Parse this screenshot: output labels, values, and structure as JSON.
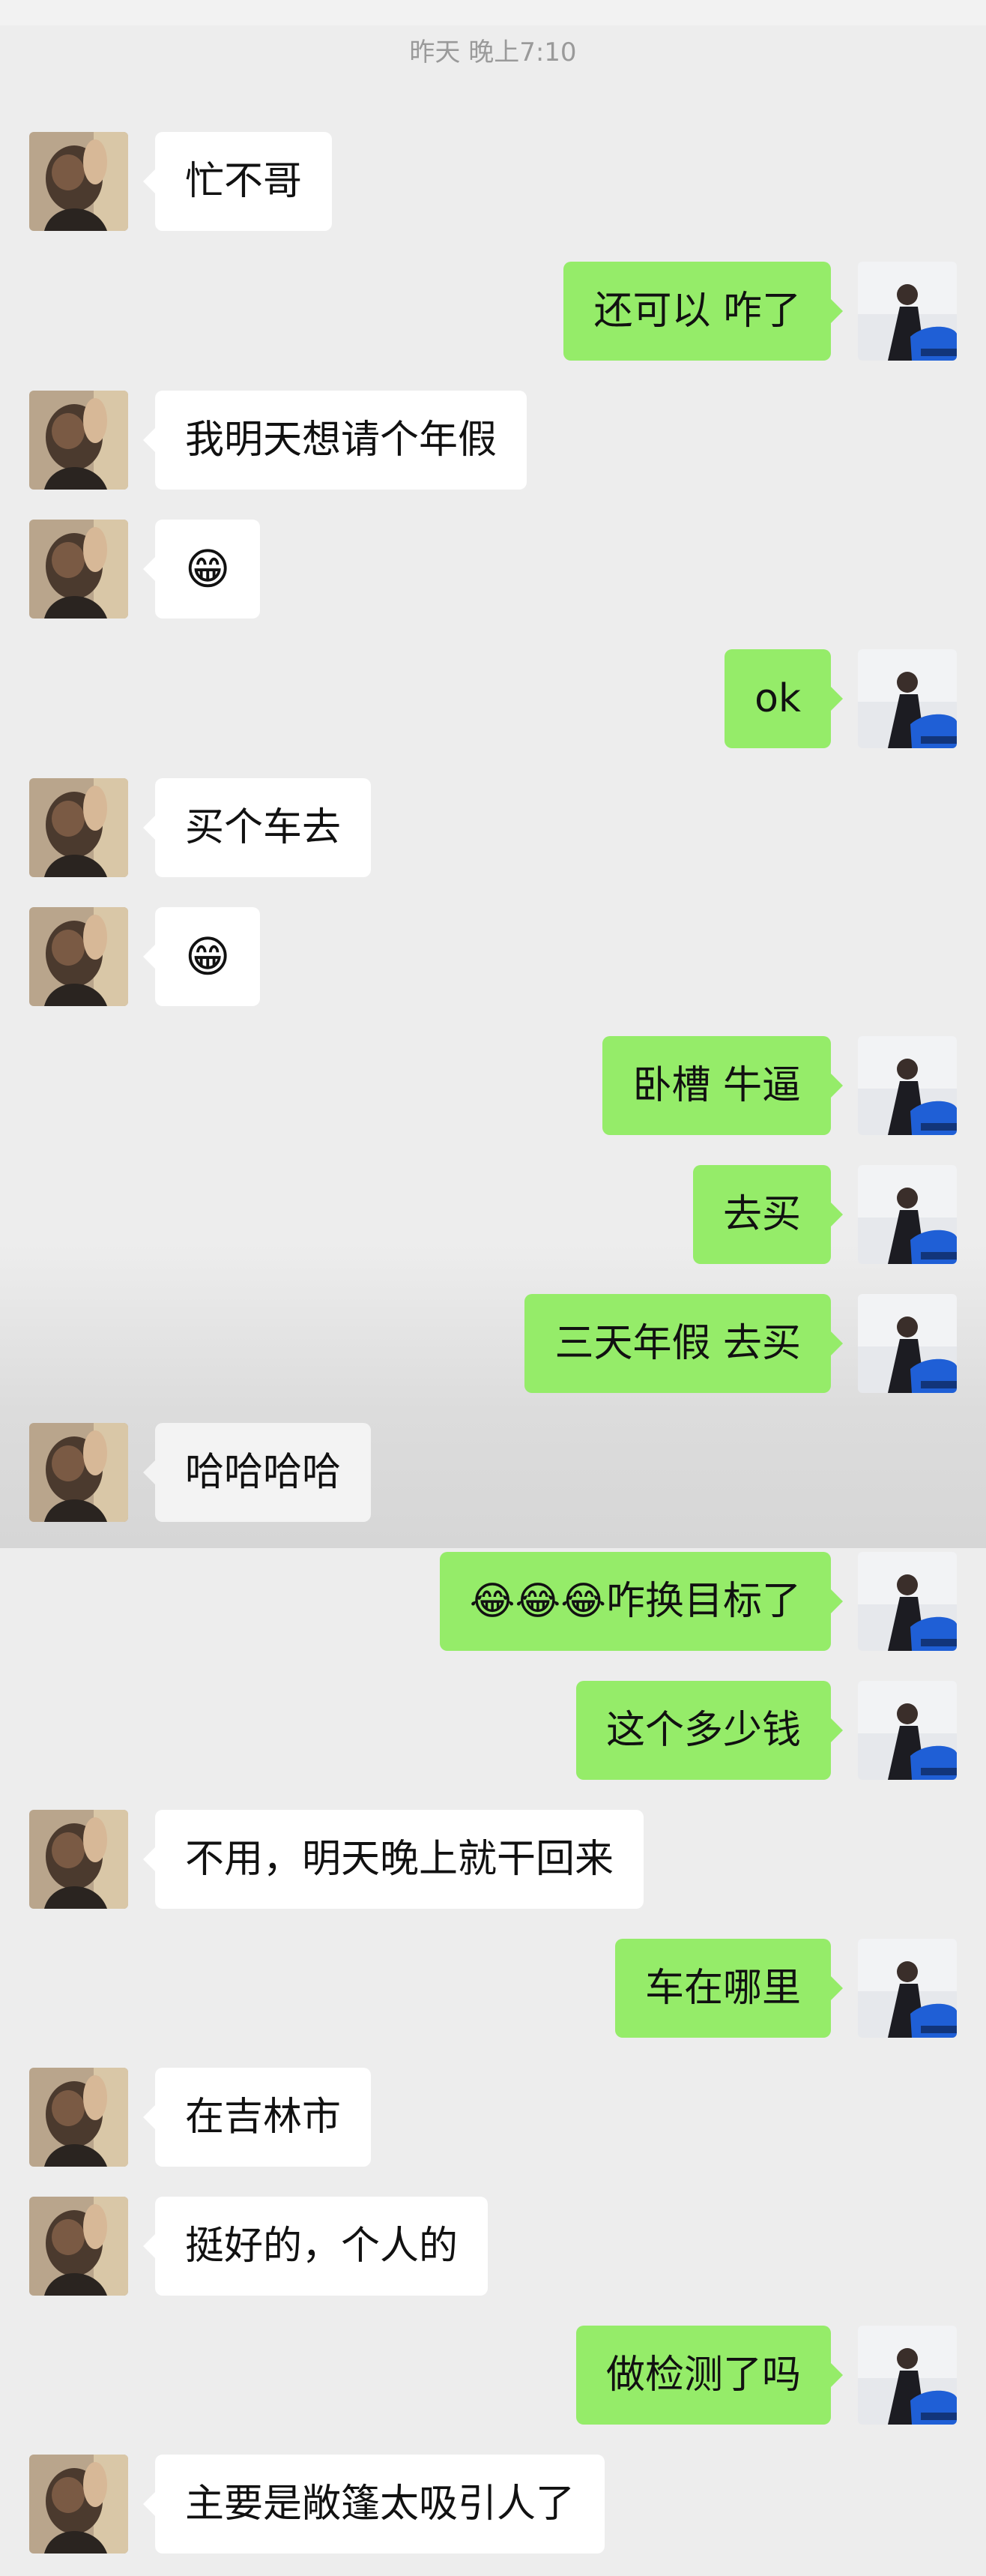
{
  "header": {
    "timestamp": "昨天 晚上7:10"
  },
  "messages": [
    {
      "side": "left",
      "text": "忙不哥"
    },
    {
      "side": "right",
      "text": "还可以 咋了"
    },
    {
      "side": "left",
      "text": "我明天想请个年假"
    },
    {
      "side": "left",
      "text": "😁"
    },
    {
      "side": "right",
      "text": "ok"
    },
    {
      "side": "left",
      "text": "买个车去"
    },
    {
      "side": "left",
      "text": "😁"
    },
    {
      "side": "right",
      "text": "卧槽 牛逼"
    },
    {
      "side": "right",
      "text": "去买"
    },
    {
      "side": "right",
      "text": "三天年假 去买"
    },
    {
      "side": "left",
      "text": "哈哈哈哈"
    },
    {
      "side": "right",
      "text": "😂😂😂咋换目标了"
    },
    {
      "side": "right",
      "text": "这个多少钱"
    },
    {
      "side": "left",
      "text": "不用，明天晚上就干回来"
    },
    {
      "side": "right",
      "text": "车在哪里"
    },
    {
      "side": "left",
      "text": "在吉林市"
    },
    {
      "side": "left",
      "text": "挺好的，个人的"
    },
    {
      "side": "right",
      "text": "做检测了吗"
    },
    {
      "side": "left",
      "text": "主要是敞篷太吸引人了"
    }
  ],
  "colors": {
    "background": "#ededed",
    "sent_bubble": "#95ec69",
    "received_bubble": "#ffffff",
    "timestamp_text": "#9a9a9a"
  },
  "icons": {
    "left_avatar": "contact-avatar-icon",
    "right_avatar": "user-avatar-icon"
  }
}
